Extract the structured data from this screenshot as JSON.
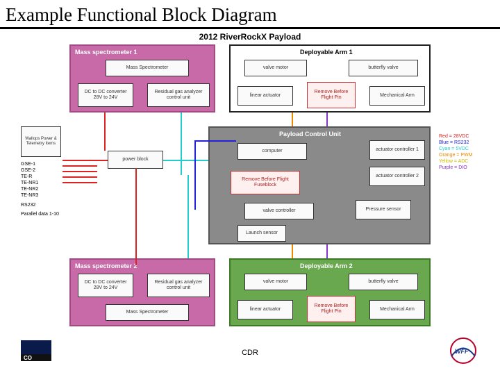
{
  "slide_title": "Example Functional Block Diagram",
  "diagram_title": "2012 RiverRockX Payload",
  "footer": "CDR",
  "modules": {
    "ms1": {
      "title": "Mass spectrometer 1",
      "bg": "#c96aa8",
      "border": "#a04b86",
      "boxes": [
        {
          "label": "Mass Spectrometer"
        },
        {
          "label": "DC to DC converter 28V to 24V"
        },
        {
          "label": "Residual gas analyzer control unit"
        }
      ]
    },
    "arm1": {
      "title": "Deployable Arm 1",
      "bg": "#ffffff",
      "border": "#1a1a1a",
      "boxes": [
        {
          "label": "valve motor"
        },
        {
          "label": "butterfly valve"
        },
        {
          "label": "linear actuator"
        },
        {
          "label": "Remove Before Flight Pin",
          "red": true
        },
        {
          "label": "Mechanical Arm"
        }
      ]
    },
    "pcu": {
      "title": "Payload Control Unit",
      "bg": "#8a8a8a",
      "border": "#555",
      "boxes": [
        {
          "label": "computer"
        },
        {
          "label": "actuator controller 1"
        },
        {
          "label": "actuator controller 2"
        },
        {
          "label": "Remove Before Flight Fuseblock",
          "red": true
        },
        {
          "label": "valve controller"
        },
        {
          "label": "Pressure sensor"
        },
        {
          "label": "Launch sensor"
        }
      ]
    },
    "ms2": {
      "title": "Mass spectrometer 2",
      "bg": "#c96aa8",
      "border": "#a04b86",
      "boxes": [
        {
          "label": "DC to DC converter 28V to 24V"
        },
        {
          "label": "Residual gas analyzer control unit"
        },
        {
          "label": "Mass Spectrometer"
        }
      ]
    },
    "arm2": {
      "title": "Deployable Arm 2",
      "bg": "#6aa84f",
      "border": "#3d7a28",
      "boxes": [
        {
          "label": "valve motor"
        },
        {
          "label": "butterfly valve"
        },
        {
          "label": "linear actuator"
        },
        {
          "label": "Remove Before Flight Pin",
          "red": true
        },
        {
          "label": "Mechanical Arm"
        }
      ]
    }
  },
  "power_block": {
    "label": "power block"
  },
  "left_legend": {
    "title": "Wallops Power & Telemetry Items",
    "items": [
      "GSE-1",
      "GSE-2",
      "TE-R",
      "TE-NR1",
      "TE-NR2",
      "TE-NR3",
      "RS232",
      "Parallel data 1-10"
    ]
  },
  "right_legend": {
    "items": [
      {
        "label": "Red = 28VDC",
        "color": "#d22"
      },
      {
        "label": "Blue = RS232",
        "color": "#22d"
      },
      {
        "label": "Cyan = 5VDC",
        "color": "#2cc"
      },
      {
        "label": "Orange = PWM",
        "color": "#e80"
      },
      {
        "label": "Yellow = ADC",
        "color": "#cb0"
      },
      {
        "label": "Purple = DIO",
        "color": "#83c"
      }
    ]
  },
  "logos": {
    "left": "CO",
    "right": "WFF"
  }
}
